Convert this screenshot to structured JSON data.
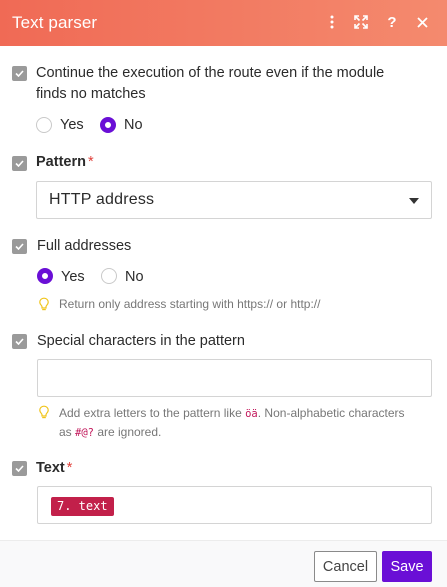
{
  "header": {
    "title": "Text parser",
    "actions": [
      "more-vertical-icon",
      "expand-icon",
      "help-icon",
      "close-icon"
    ]
  },
  "colors": {
    "header_start": "#f06a55",
    "header_end": "#f48a6e",
    "accent": "#6a0fd6",
    "required": "#e0403a",
    "pill": "#c2204a"
  },
  "continue_execution": {
    "label": "Continue the execution of the route even if the module finds no matches",
    "label_line1": "Continue the execution of the route even if the module",
    "label_line2": "finds no matches",
    "options": [
      "Yes",
      "No"
    ],
    "selected": "No"
  },
  "pattern": {
    "label": "Pattern",
    "required_mark": "*",
    "value": "HTTP address"
  },
  "full_addresses": {
    "label": "Full addresses",
    "options": [
      "Yes",
      "No"
    ],
    "selected": "Yes",
    "hint": "Return only address starting with https:// or http://"
  },
  "special_chars": {
    "label": "Special characters in the pattern",
    "value": "",
    "hint_part1": "Add extra letters to the pattern like ",
    "hint_code1": "öä",
    "hint_part2": ". Non-alphabetic characters",
    "hint_part3": "as ",
    "hint_code2": "#@?",
    "hint_part4": " are ignored."
  },
  "text": {
    "label": "Text",
    "required_mark": "*",
    "pill": "7. text"
  },
  "footer": {
    "cancel_label": "Cancel",
    "save_label": "Save"
  }
}
